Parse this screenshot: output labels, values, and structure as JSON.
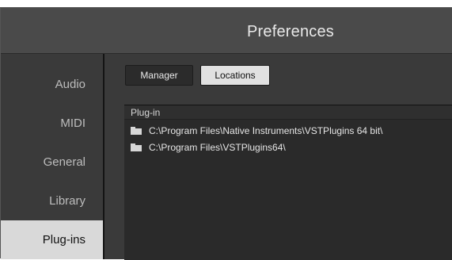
{
  "window": {
    "title": "Preferences"
  },
  "sidebar": {
    "items": [
      {
        "label": "Audio",
        "active": false
      },
      {
        "label": "MIDI",
        "active": false
      },
      {
        "label": "General",
        "active": false
      },
      {
        "label": "Library",
        "active": false
      },
      {
        "label": "Plug-ins",
        "active": true
      }
    ]
  },
  "toolbar": {
    "manager_label": "Manager",
    "locations_label": "Locations",
    "selected": "Locations"
  },
  "plugin_list": {
    "header": "Plug-in",
    "rows": [
      {
        "icon": "folder-icon",
        "path": "C:\\Program Files\\Native Instruments\\VSTPlugins 64 bit\\"
      },
      {
        "icon": "folder-icon",
        "path": "C:\\Program Files\\VSTPlugins64\\"
      }
    ]
  },
  "colors": {
    "titlebar": "#4a4a4a",
    "panel": "#3a3a3a",
    "list_bg": "#2a2a2a",
    "active_item": "#d9d9d9",
    "text": "#e6e6e6"
  }
}
